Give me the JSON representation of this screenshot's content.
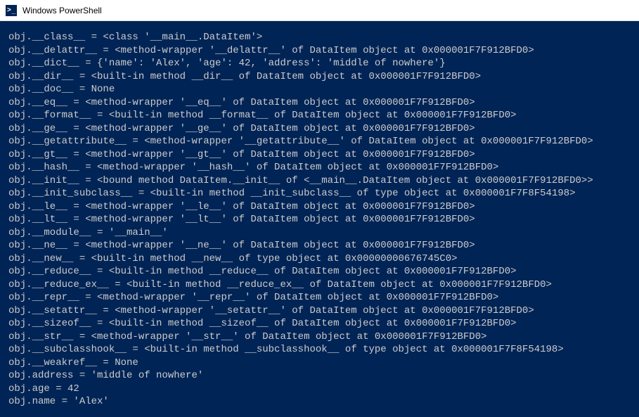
{
  "titlebar": {
    "title": "Windows PowerShell"
  },
  "terminal": {
    "lines": [
      "obj.__class__ = <class '__main__.DataItem'>",
      "obj.__delattr__ = <method-wrapper '__delattr__' of DataItem object at 0x000001F7F912BFD0>",
      "obj.__dict__ = {'name': 'Alex', 'age': 42, 'address': 'middle of nowhere'}",
      "obj.__dir__ = <built-in method __dir__ of DataItem object at 0x000001F7F912BFD0>",
      "obj.__doc__ = None",
      "obj.__eq__ = <method-wrapper '__eq__' of DataItem object at 0x000001F7F912BFD0>",
      "obj.__format__ = <built-in method __format__ of DataItem object at 0x000001F7F912BFD0>",
      "obj.__ge__ = <method-wrapper '__ge__' of DataItem object at 0x000001F7F912BFD0>",
      "obj.__getattribute__ = <method-wrapper '__getattribute__' of DataItem object at 0x000001F7F912BFD0>",
      "obj.__gt__ = <method-wrapper '__gt__' of DataItem object at 0x000001F7F912BFD0>",
      "obj.__hash__ = <method-wrapper '__hash__' of DataItem object at 0x000001F7F912BFD0>",
      "obj.__init__ = <bound method DataItem.__init__ of <__main__.DataItem object at 0x000001F7F912BFD0>>",
      "obj.__init_subclass__ = <built-in method __init_subclass__ of type object at 0x000001F7F8F54198>",
      "obj.__le__ = <method-wrapper '__le__' of DataItem object at 0x000001F7F912BFD0>",
      "obj.__lt__ = <method-wrapper '__lt__' of DataItem object at 0x000001F7F912BFD0>",
      "obj.__module__ = '__main__'",
      "obj.__ne__ = <method-wrapper '__ne__' of DataItem object at 0x000001F7F912BFD0>",
      "obj.__new__ = <built-in method __new__ of type object at 0x00000000676745C0>",
      "obj.__reduce__ = <built-in method __reduce__ of DataItem object at 0x000001F7F912BFD0>",
      "obj.__reduce_ex__ = <built-in method __reduce_ex__ of DataItem object at 0x000001F7F912BFD0>",
      "obj.__repr__ = <method-wrapper '__repr__' of DataItem object at 0x000001F7F912BFD0>",
      "obj.__setattr__ = <method-wrapper '__setattr__' of DataItem object at 0x000001F7F912BFD0>",
      "obj.__sizeof__ = <built-in method __sizeof__ of DataItem object at 0x000001F7F912BFD0>",
      "obj.__str__ = <method-wrapper '__str__' of DataItem object at 0x000001F7F912BFD0>",
      "obj.__subclasshook__ = <built-in method __subclasshook__ of type object at 0x000001F7F8F54198>",
      "obj.__weakref__ = None",
      "obj.address = 'middle of nowhere'",
      "obj.age = 42",
      "obj.name = 'Alex'"
    ]
  }
}
